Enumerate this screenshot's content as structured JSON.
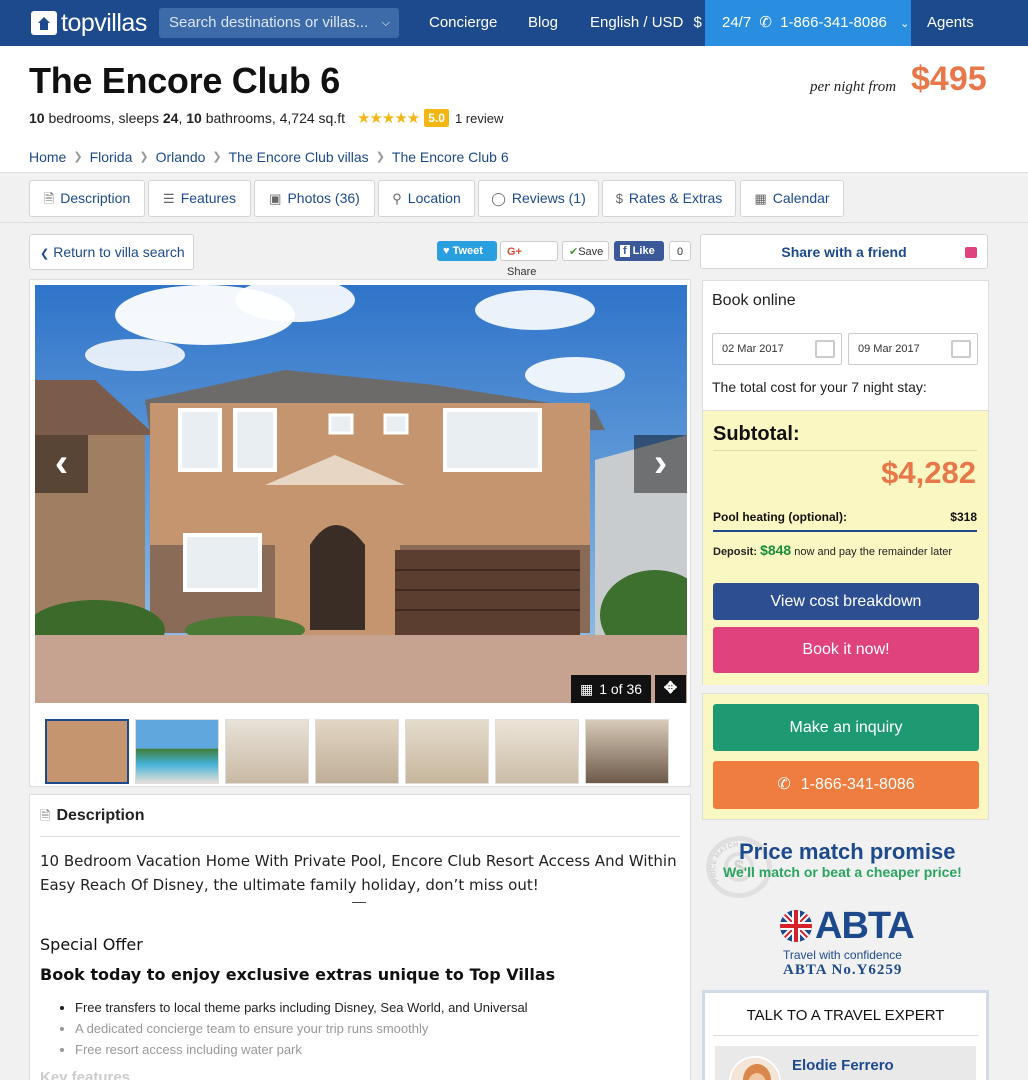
{
  "nav": {
    "logo": "topvillas",
    "search_placeholder": "Search destinations or villas...",
    "concierge": "Concierge",
    "blog": "Blog",
    "language": "English / USD",
    "currency_icon": "$",
    "phone_label": "24/7",
    "phone": "1-866-341-8086",
    "agents": "Agents"
  },
  "villa": {
    "title": "The Encore Club 6",
    "bedrooms": "10",
    "bedrooms_label": "bedrooms, sleeps",
    "sleeps": "24",
    "bathrooms": "10",
    "bathrooms_label": "bathrooms, 4,724 sq.ft",
    "stars": "★★★★★",
    "rating": "5.0",
    "review_count": "1 review",
    "per_night_label": "per night from",
    "price": "$495"
  },
  "breadcrumbs": [
    "Home",
    "Florida",
    "Orlando",
    "The Encore Club villas",
    "The Encore Club 6"
  ],
  "tabs": {
    "description": "Description",
    "features": "Features",
    "photos": "Photos (36)",
    "location": "Location",
    "reviews": "Reviews (1)",
    "rates": "Rates & Extras",
    "calendar": "Calendar"
  },
  "actions": {
    "return": "Return to villa search",
    "tweet": "Tweet",
    "gplus": "Share",
    "save": "Save",
    "like": "Like",
    "like_count": "0",
    "share_friend": "Share with a friend"
  },
  "gallery": {
    "counter": "1 of 36",
    "thumb_count": 7
  },
  "description": {
    "heading": "Description",
    "intro": "10 Bedroom Vacation Home With Private Pool, Encore Club Resort Access And Within Easy Reach Of Disney, the ultimate family holiday, don’t miss out!",
    "special_offer": "Special Offer",
    "special_sub": "Book today to enjoy exclusive extras unique to Top Villas",
    "bullets": [
      "Free transfers to local theme parks including Disney, Sea World, and Universal",
      "A dedicated concierge team to ensure your trip runs smoothly",
      "Free resort access including water park"
    ],
    "next_heading": "Key features"
  },
  "booking": {
    "heading": "Book online",
    "checkin": "02 Mar 2017",
    "checkout": "09 Mar 2017",
    "total_text": "The total cost for your 7 night stay:",
    "subtotal_label": "Subtotal:",
    "subtotal": "$4,282",
    "pool_label": "Pool heating (optional):",
    "pool_value": "$318",
    "deposit_label": "Deposit:",
    "deposit_amount": "$848",
    "deposit_text": "now and pay the remainder later",
    "breakdown_btn": "View cost breakdown",
    "book_btn": "Book it now!",
    "inquiry_btn": "Make an inquiry",
    "call_btn": "1-866-341-8086"
  },
  "promise": {
    "badge_text": "PRICE MATCH",
    "title": "Price match promise",
    "sub": "We'll match or beat a cheaper price!"
  },
  "abta": {
    "name": "ABTA",
    "tagline": "Travel with confidence",
    "number": "ABTA No.Y6259"
  },
  "expert": {
    "heading": "TALK TO A TRAVEL EXPERT",
    "name": "Elodie Ferrero"
  },
  "colors": {
    "brand": "#1d4a8c",
    "accent_price": "#e8774a",
    "breakdown_btn": "#2d4f92",
    "book_btn": "#e0427e",
    "inquiry_btn": "#1e9a72",
    "call_btn": "#ee7d3f",
    "highlight_bg": "#fbf7c2"
  }
}
